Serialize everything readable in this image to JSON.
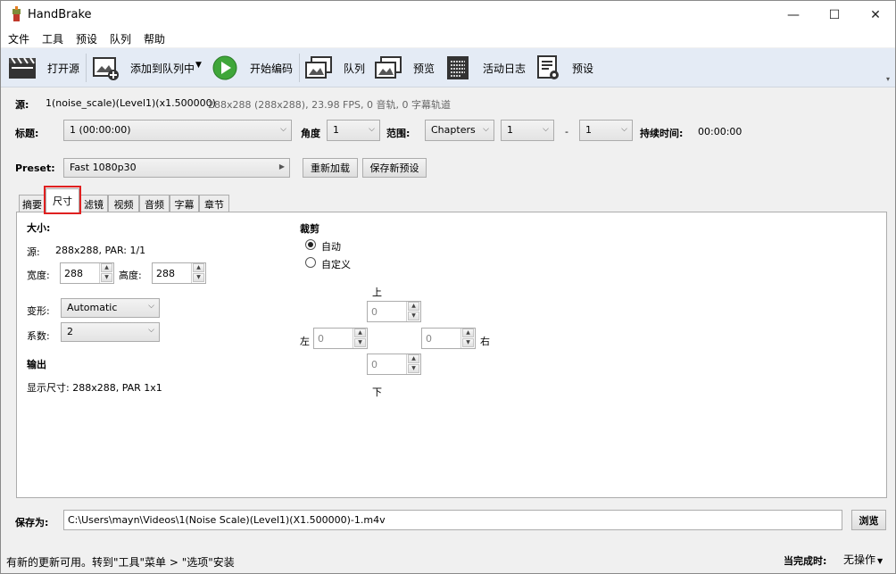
{
  "window": {
    "title": "HandBrake",
    "minimize": "—",
    "maximize": "☐",
    "close": "✕"
  },
  "menu": [
    "文件",
    "工具",
    "预设",
    "队列",
    "帮助"
  ],
  "toolbar": {
    "open_source": "打开源",
    "add_to_queue": "添加到队列中",
    "start_encode": "开始编码",
    "queue": "队列",
    "preview": "预览",
    "activity_log": "活动日志",
    "presets": "预设"
  },
  "source": {
    "label": "源:",
    "name": "1(noise_scale)(Level1)(x1.500000)",
    "info": "288x288 (288x288), 23.98 FPS, 0 音轨, 0 字幕轨道"
  },
  "title_row": {
    "title_label": "标题:",
    "title_value": "1  (00:00:00)",
    "angle_label": "角度",
    "angle_value": "1",
    "range_label": "范围:",
    "range_type": "Chapters",
    "range_start": "1",
    "range_dash": "-",
    "range_end": "1",
    "duration_label": "持续时间:",
    "duration_value": "00:00:00"
  },
  "preset_row": {
    "label": "Preset:",
    "value": "Fast 1080p30",
    "reload": "重新加载",
    "save_new": "保存新预设"
  },
  "tabs": [
    "摘要",
    "尺寸",
    "滤镜",
    "视频",
    "音频",
    "字幕",
    "章节"
  ],
  "active_tab": "尺寸",
  "size": {
    "heading": "大小:",
    "source_label": "源:",
    "source_value": "288x288, PAR: 1/1",
    "width_label": "宽度:",
    "width_value": "288",
    "height_label": "高度:",
    "height_value": "288",
    "anamorphic_label": "变形:",
    "anamorphic_value": "Automatic",
    "modulus_label": "系数:",
    "modulus_value": "2",
    "output_heading": "输出",
    "display_size": "显示尺寸:  288x288,  PAR 1x1"
  },
  "crop": {
    "heading": "裁剪",
    "auto": "自动",
    "custom": "自定义",
    "selected": "自动",
    "top_label": "上",
    "bottom_label": "下",
    "left_label": "左",
    "right_label": "右",
    "top": "0",
    "bottom": "0",
    "left": "0",
    "right": "0"
  },
  "save_row": {
    "label": "保存为:",
    "path": "C:\\Users\\mayn\\Videos\\1(Noise Scale)(Level1)(X1.500000)-1.m4v",
    "browse": "浏览"
  },
  "status": {
    "message": "有新的更新可用。转到\"工具\"菜单 > \"选项\"安装",
    "when_done_label": "当完成时:",
    "when_done_value": "无操作"
  },
  "colors": {
    "highlight_box": "#e02020",
    "play_green": "#3fa63a",
    "toolbar_bg": "#e4ebf5"
  }
}
